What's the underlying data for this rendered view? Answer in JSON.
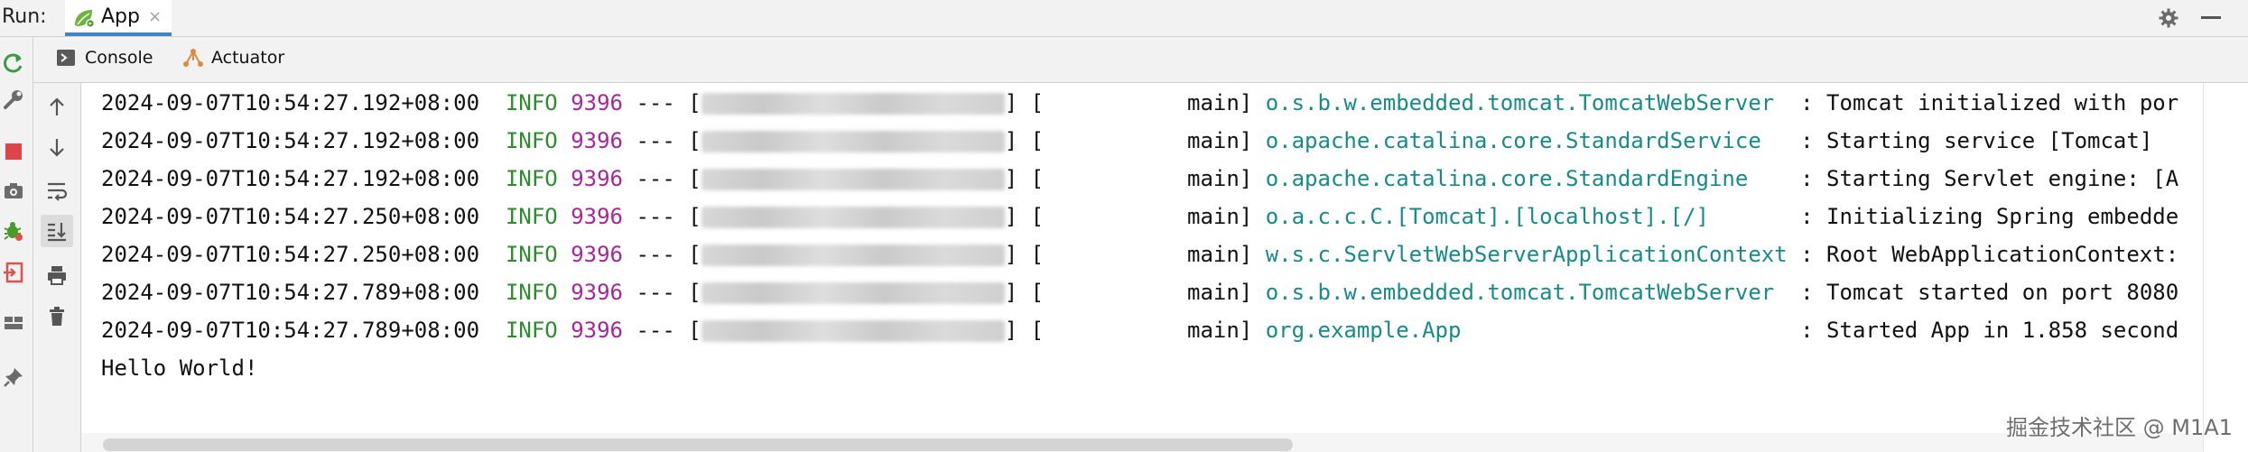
{
  "run_header": {
    "label": "Run:",
    "tab_label": "App",
    "tab_close": "×",
    "tab_icon": "spring-app-icon",
    "settings_icon": "gear-icon",
    "minimize_icon": "minimize-icon"
  },
  "left_toolbar": {
    "icons": [
      "rerun-icon",
      "wrench-icon",
      "stop-icon",
      "camera-icon",
      "debug-bug-icon",
      "exit-icon",
      "layout-icon",
      "pin-icon"
    ]
  },
  "sub_toolbar": {
    "tabs": [
      {
        "label": "Console",
        "icon": "console-icon"
      },
      {
        "label": "Actuator",
        "icon": "actuator-icon"
      }
    ]
  },
  "console_side": {
    "icons": [
      "arrow-up-icon",
      "arrow-down-icon",
      "soft-wrap-icon",
      "scroll-to-end-icon",
      "print-icon",
      "trash-icon"
    ]
  },
  "console": {
    "lines": [
      {
        "timestamp": "2024-09-07T10:54:27.192+08:00",
        "level": "INFO",
        "pid": "9396",
        "sep": "---",
        "thread": "main",
        "logger": "o.s.b.w.embedded.tomcat.TomcatWebServer",
        "message": ": Tomcat initialized with por"
      },
      {
        "timestamp": "2024-09-07T10:54:27.192+08:00",
        "level": "INFO",
        "pid": "9396",
        "sep": "---",
        "thread": "main",
        "logger": "o.apache.catalina.core.StandardService",
        "message": ": Starting service [Tomcat]"
      },
      {
        "timestamp": "2024-09-07T10:54:27.192+08:00",
        "level": "INFO",
        "pid": "9396",
        "sep": "---",
        "thread": "main",
        "logger": "o.apache.catalina.core.StandardEngine",
        "message": ": Starting Servlet engine: [A"
      },
      {
        "timestamp": "2024-09-07T10:54:27.250+08:00",
        "level": "INFO",
        "pid": "9396",
        "sep": "---",
        "thread": "main",
        "logger": "o.a.c.c.C.[Tomcat].[localhost].[/]",
        "message": ": Initializing Spring embedde"
      },
      {
        "timestamp": "2024-09-07T10:54:27.250+08:00",
        "level": "INFO",
        "pid": "9396",
        "sep": "---",
        "thread": "main",
        "logger": "w.s.c.ServletWebServerApplicationContext",
        "message": ": Root WebApplicationContext:"
      },
      {
        "timestamp": "2024-09-07T10:54:27.789+08:00",
        "level": "INFO",
        "pid": "9396",
        "sep": "---",
        "thread": "main",
        "logger": "o.s.b.w.embedded.tomcat.TomcatWebServer",
        "message": ": Tomcat started on port 8080"
      },
      {
        "timestamp": "2024-09-07T10:54:27.789+08:00",
        "level": "INFO",
        "pid": "9396",
        "sep": "---",
        "thread": "main",
        "logger": "org.example.App",
        "message": ": Started App in 1.858 second"
      }
    ],
    "hello": "Hello World!"
  },
  "watermark": "掘金技术社区 @ M1A1",
  "colors": {
    "info": "#2d8c2d",
    "pid": "#a8269c",
    "logger": "#178b8b",
    "tab_underline": "#4083c9"
  }
}
